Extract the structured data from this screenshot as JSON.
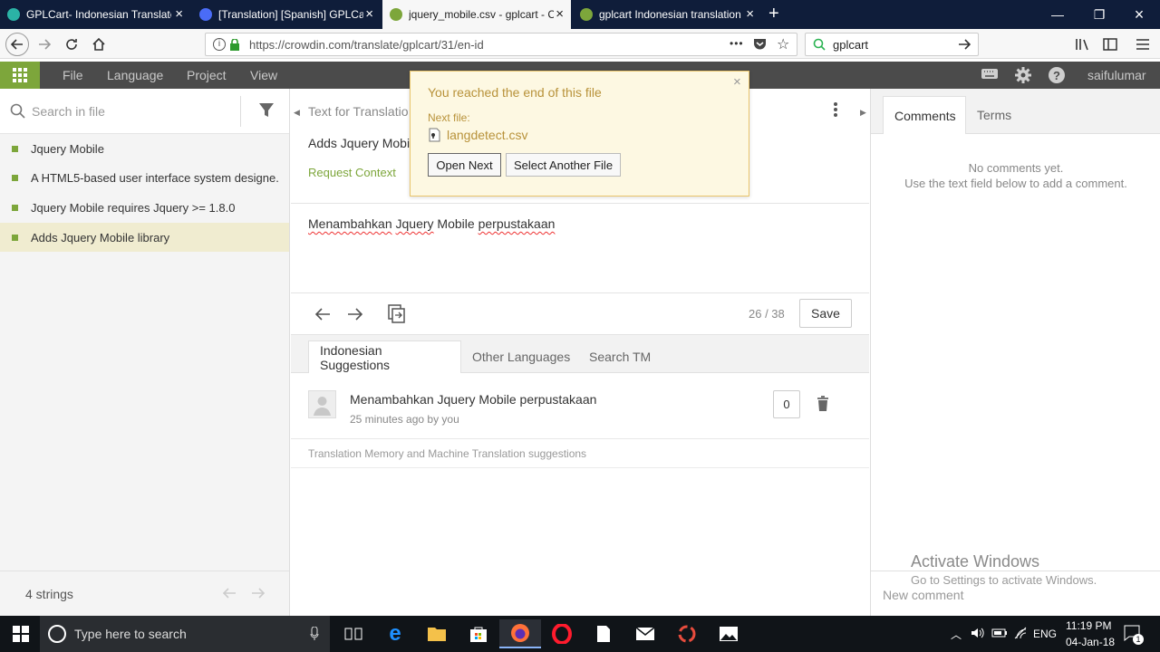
{
  "browser": {
    "tabs": [
      {
        "title": "GPLCart- Indonesian Translated",
        "active": false,
        "favicon_color": "#2bb3a6"
      },
      {
        "title": "[Translation] [Spanish] GPLCart",
        "active": false,
        "favicon_color": "#4a6cf7"
      },
      {
        "title": "jquery_mobile.csv - gplcart - Cr",
        "active": true,
        "favicon_color": "#7da63b"
      },
      {
        "title": "gplcart Indonesian translation a",
        "active": false,
        "favicon_color": "#7da63b"
      }
    ],
    "new_tab_label": "+",
    "url": "https://crowdin.com/translate/gplcart/31/en-id",
    "search_value": "gplcart",
    "url_more": "•••"
  },
  "app": {
    "menu": [
      "File",
      "Language",
      "Project",
      "View"
    ],
    "username": "saifulumar",
    "accent": "#7da63b"
  },
  "left": {
    "search_placeholder": "Search in file",
    "strings": [
      {
        "text": "Jquery Mobile",
        "selected": false
      },
      {
        "text": "A HTML5-based user interface system designe...",
        "selected": false
      },
      {
        "text": "Jquery Mobile requires Jquery >= 1.8.0",
        "selected": false
      },
      {
        "text": "Adds Jquery Mobile library",
        "selected": true
      }
    ],
    "count_label": "4 strings"
  },
  "middle": {
    "source_header": "Text for Translatio",
    "source_text": "Adds Jquery Mobile library",
    "request_context": "Request Context",
    "translation_words": [
      "Menambahkan",
      " ",
      "Jquery",
      " Mobile ",
      "perpustakaan"
    ],
    "counter": "26 / 38",
    "save_label": "Save",
    "suggestion_tabs": [
      "Indonesian Suggestions",
      "Other Languages",
      "Search TM"
    ],
    "suggestion": {
      "text": "Menambahkan Jquery Mobile perpustakaan",
      "meta": "25 minutes ago by you",
      "votes": "0"
    },
    "tm_note": "Translation Memory and Machine Translation suggestions"
  },
  "popup": {
    "title": "You reached the end of this file",
    "next_label": "Next file:",
    "next_file": "langdetect.csv",
    "open_next": "Open Next",
    "select_another": "Select Another File",
    "close": "×"
  },
  "right": {
    "tabs": [
      "Comments",
      "Terms"
    ],
    "no_comments": "No comments yet.",
    "hint": "Use the text field below to add a comment.",
    "new_comment_placeholder": "New comment"
  },
  "watermark": {
    "title": "Activate Windows",
    "subtitle": "Go to Settings to activate Windows."
  },
  "taskbar": {
    "search_placeholder": "Type here to search",
    "language": "ENG",
    "time": "11:19 PM",
    "date": "04-Jan-18",
    "notification_count": "1"
  }
}
